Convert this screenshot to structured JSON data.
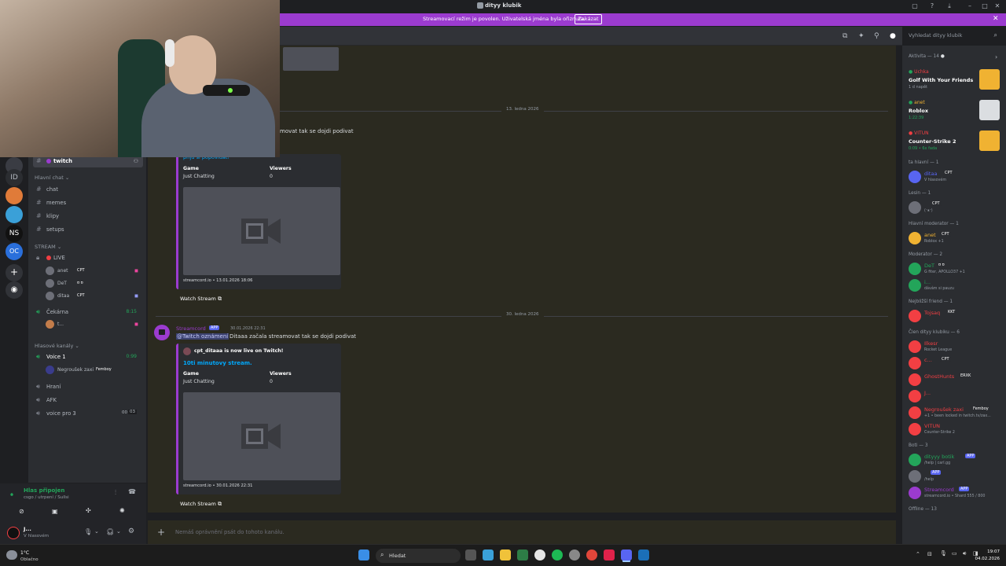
{
  "window": {
    "title": "dityy klubik"
  },
  "banner": {
    "text": "Streamovací režim je povolen. Uživatelská jména byla ořiznuta.",
    "button": "Zakázat"
  },
  "search": {
    "placeholder": "Vyhledat dityy klubik"
  },
  "channels": {
    "selected": "twitch",
    "cat_main": "Hlavní chat",
    "main": [
      "chat",
      "memes",
      "klipy",
      "setups"
    ],
    "cat_stream": "STREAM",
    "live": "LIVE",
    "live_users": [
      {
        "name": "anet",
        "tag": "CPT"
      },
      {
        "name": "DeT",
        "tag": "ʊ ʊ"
      },
      {
        "name": "ditaa",
        "tag": "CPT"
      }
    ],
    "waiting": "Čekárna",
    "waiting_time": "8:15",
    "waiting_user": "t...",
    "cat_voice": "Hlasové kanály",
    "voice1": "Voice 1",
    "voice1_time": "0:99",
    "voice1_user": "Negroušek zaxi",
    "voice1_user_tag": "Femboy",
    "voice_other": [
      "Hraní",
      "AFK",
      "voice pro 3"
    ],
    "voice_pro3_counts": [
      "00",
      "03"
    ]
  },
  "voice_status": {
    "title": "Hlas připojen",
    "sub": "csgo / utrpení / Sullsi"
  },
  "user": {
    "name": "J...",
    "status": "V hlasovém"
  },
  "chat": {
    "date1": "13. ledna 2026",
    "msg1_tail": "movat tak se dojdi podivat",
    "embed1_top": "přijď si popovídat!",
    "col_game": "Game",
    "col_viewers": "Viewers",
    "embed1_game": "Just Chatting",
    "embed1_viewers": "0",
    "embed1_footer": "streamcord.io • 13.01.2026 18:06",
    "watch": "Watch Stream",
    "date2": "30. ledna 2026",
    "bot_name": "Streamcord",
    "app_badge": "APP",
    "msg2_time": "30.01.2026 22:31",
    "msg2_mention": "@Twitch oznámení",
    "msg2_text": "Ditaaa začala streamovat tak se dojdi podivat",
    "embed2_author": "cpt_ditaaa is now live on Twitch!",
    "embed2_title": "10ti minutovy stream.",
    "embed2_game": "Just Chatting",
    "embed2_viewers": "0",
    "embed2_footer": "streamcord.io • 30.01.2026 22:31"
  },
  "composer": {
    "placeholder": "Nemáš oprávnění psát do tohoto kanálu."
  },
  "members": {
    "activity_header": "Aktivita — 14",
    "activities": [
      {
        "name": "Uchka",
        "game": "Golf With Your Friends",
        "time": "1 d napět",
        "color": "#f23f43"
      },
      {
        "name": "anet",
        "game": "Roblox",
        "time": "1:22:39",
        "color": "#f0b232"
      },
      {
        "name": "VITUN",
        "game": "Counter-Strike 2",
        "time": "0:09 • 6x fada",
        "color": "#f23f43"
      }
    ],
    "groups": [
      {
        "title": "ta hlavní — 1",
        "items": [
          {
            "name": "ditaa",
            "badge": "CPT",
            "status": "V hlasovém",
            "color": "#5865f2"
          }
        ]
      },
      {
        "title": "Lesin — 1",
        "items": [
          {
            "name": "",
            "badge": "CPT",
            "status": "(ᵔᴥᵔ)",
            "color": "#dbdee1"
          }
        ]
      },
      {
        "title": "Hlavní moderator — 1",
        "items": [
          {
            "name": "anet",
            "badge": "CPT",
            "status": "Roblox +1",
            "color": "#f0b232"
          }
        ]
      },
      {
        "title": "Moderator — 2",
        "items": [
          {
            "name": "DeT",
            "badge": "ʊ ʊ",
            "status": "G fiter, APOLLO37 +1",
            "color": "#23a55a"
          },
          {
            "name": "i...",
            "badge": "",
            "status": "dávám si pauzu",
            "color": "#23a55a"
          }
        ]
      },
      {
        "title": "Nejbližší friend — 1",
        "items": [
          {
            "name": "Tojsaq",
            "badge": "KKT",
            "status": "",
            "color": "#f23f43"
          }
        ]
      },
      {
        "title": "Člen dityy klubiku — 6",
        "items": [
          {
            "name": "Ilkesr",
            "badge": "",
            "status": "Rocket League",
            "color": "#f23f43"
          },
          {
            "name": "c...",
            "badge": "CPT",
            "status": "",
            "color": "#f23f43"
          },
          {
            "name": "GhostHunts",
            "badge": "ERXK",
            "status": "",
            "color": "#f23f43"
          },
          {
            "name": "J...",
            "badge": "",
            "status": "",
            "color": "#f23f43"
          },
          {
            "name": "Negroušek zaxi",
            "badge": "Femboy",
            "status": "+1 • been locked in twitch.tv/zax...",
            "color": "#f23f43"
          },
          {
            "name": "VITUN",
            "badge": "",
            "status": "Counter-Strike 2",
            "color": "#f23f43"
          }
        ]
      },
      {
        "title": "Boti — 3",
        "items": [
          {
            "name": "dityyy botik",
            "badge": "APP",
            "status": "/help | carl.gg",
            "color": "#23a55a"
          },
          {
            "name": "",
            "badge": "APP",
            "status": "/help",
            "color": "#dbdee1"
          },
          {
            "name": "Streamcord",
            "badge": "APP",
            "status": "streamcord.io • Shard 555 / 800",
            "color": "#9b3bcf"
          }
        ]
      },
      {
        "title": "Offline — 13",
        "items": []
      }
    ]
  },
  "taskbar": {
    "weather_temp": "1°C",
    "weather_desc": "Oblačno",
    "search": "Hledat",
    "time": "19:07",
    "date": "04.02.2026"
  },
  "colors": {
    "accent": "#9b3bcf",
    "app_badge": "#5865f2",
    "online": "#23a55a"
  }
}
